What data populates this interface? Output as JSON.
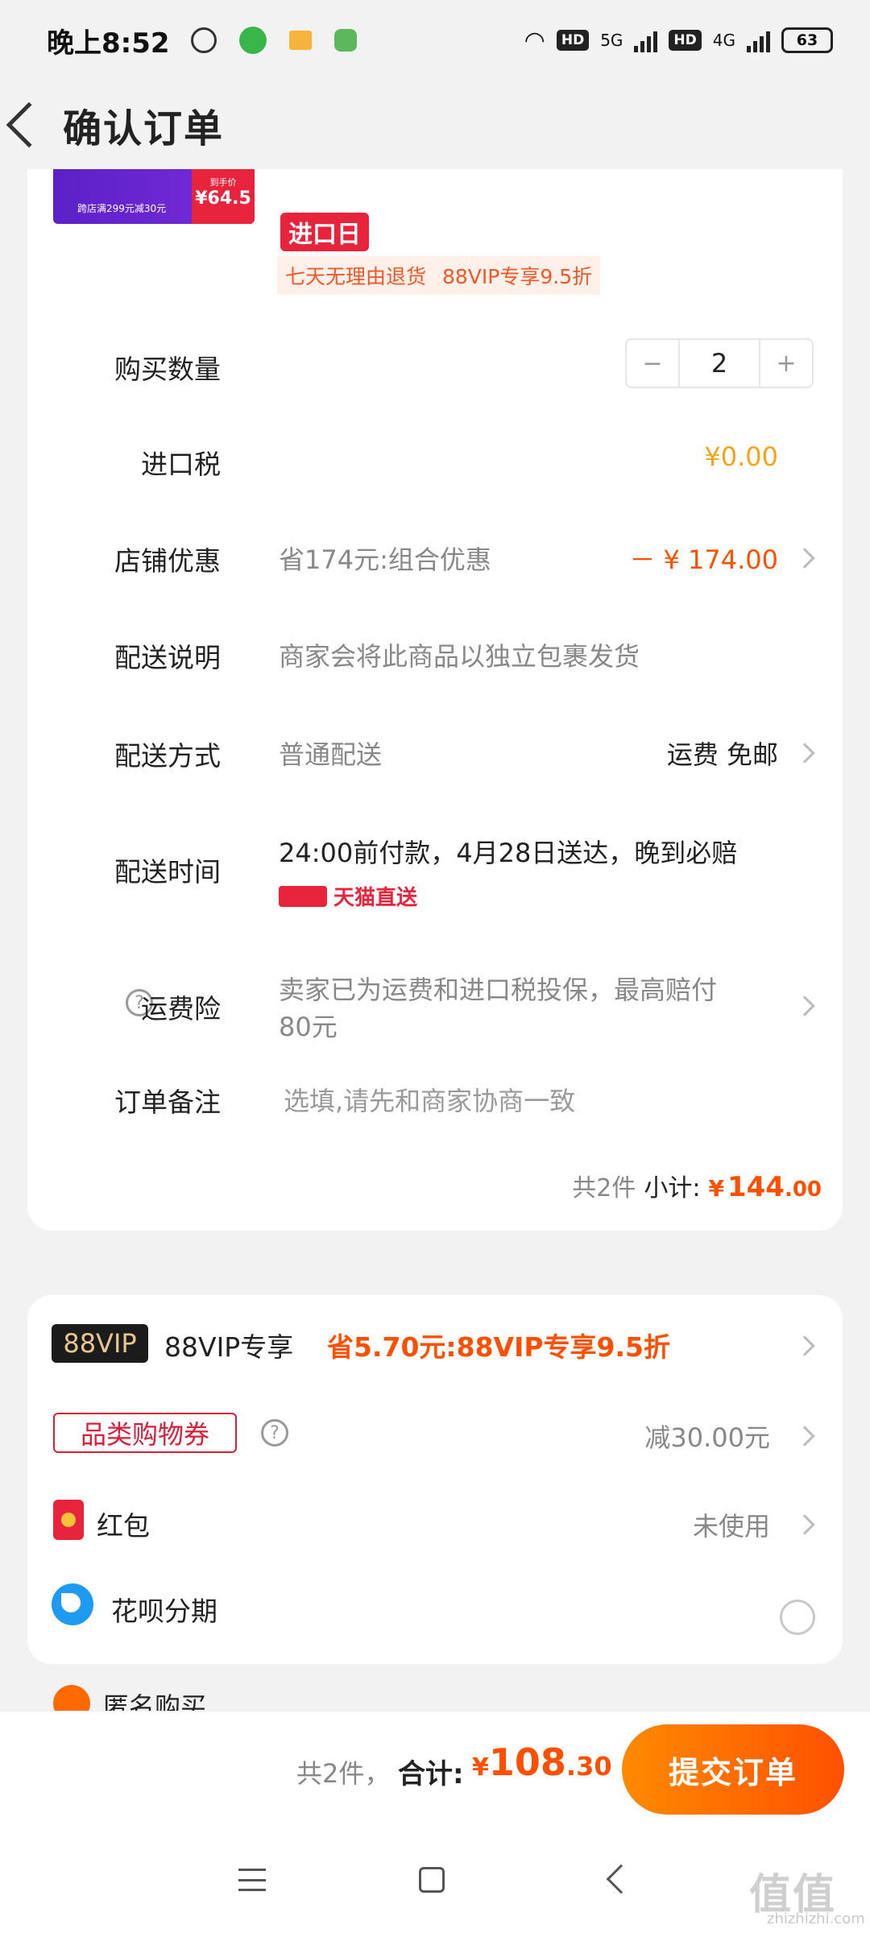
{
  "status_bar": {
    "time": "晚上8:52",
    "hd1": "HD",
    "net1": "5G",
    "hd2": "HD",
    "net2": "4G",
    "battery": "63"
  },
  "header": {
    "title": "确认订单"
  },
  "product": {
    "thumb_promo": "跨店满299元减30元",
    "thumb_price_label": "到手价",
    "thumb_price": "¥64.5",
    "import_tag": "进口日",
    "tags": [
      "七天无理由退货",
      "88VIP专享9.5折"
    ]
  },
  "order_rows": {
    "quantity_label": "购买数量",
    "quantity_value": "2",
    "stepper_minus": "−",
    "stepper_plus": "+",
    "import_tax_label": "进口税",
    "import_tax_value": "¥0.00",
    "shop_discount_label": "店铺优惠",
    "shop_discount_desc": "省174元:组合优惠",
    "shop_discount_value": "－ ¥ 174.00",
    "delivery_note_label": "配送说明",
    "delivery_note_value": "商家会将此商品以独立包裹发货",
    "delivery_method_label": "配送方式",
    "delivery_method_value": "普通配送",
    "shipping_fee": "运费 免邮",
    "delivery_time_label": "配送时间",
    "delivery_time_value": "24:00前付款，4月28日送达，晚到必赔",
    "tmall_direct": "天猫直送",
    "insurance_label": "运费险",
    "insurance_value_line1": "卖家已为运费和进口税投保，最高赔付",
    "insurance_value_line2": "80元",
    "remark_label": "订单备注",
    "remark_placeholder": "选填,请先和商家协商一致",
    "subtotal_count": "共2件",
    "subtotal_label": "小计:",
    "subtotal_currency": "¥",
    "subtotal_int": "144",
    "subtotal_dec": ".00"
  },
  "benefits": {
    "vip_badge": "88VIP",
    "vip_label": "88VIP专享",
    "vip_value": "省5.70元:88VIP专享9.5折",
    "coupon_badge": "品类购物券",
    "coupon_value": "减30.00元",
    "redpack_label": "红包",
    "redpack_value": "未使用",
    "huabei_label": "花呗分期"
  },
  "anonymous": {
    "label": "匿名购买"
  },
  "bottom_bar": {
    "count": "共2件，",
    "total_label": "合计:",
    "currency": "¥",
    "total_int": "108",
    "total_dec": ".30",
    "submit": "提交订单"
  },
  "watermark": {
    "main": "值值值",
    "sub": "zhizhizhi.com"
  }
}
